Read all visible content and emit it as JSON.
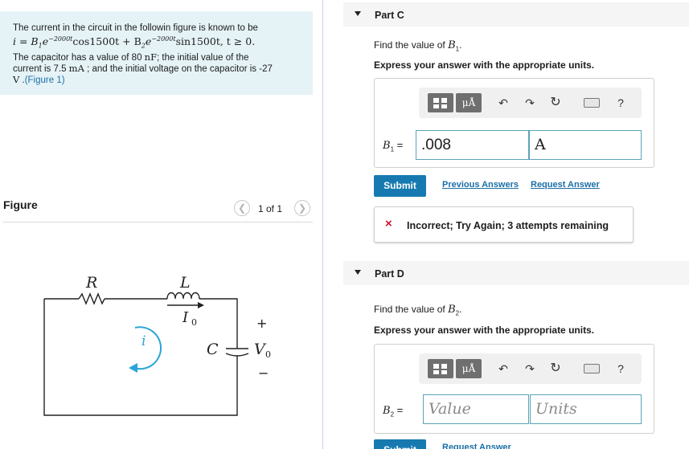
{
  "problem": {
    "line1": "The current in the circuit in the followin figure is known to be",
    "equation_part1": "i = B",
    "equation_sub1": "1",
    "equation_part2": "e",
    "equation_sup1": "−2000t",
    "equation_part3": "cos1500t + B",
    "equation_sub2": "2",
    "equation_part4": "e",
    "equation_sup2": "−2000t",
    "equation_part5": "sin1500t, t ≥ 0.",
    "line3a": "The capacitor has a value of 80 ",
    "line3b": "nF",
    "line3c": "; the initial value of the",
    "line4a": "current is 7.5 ",
    "line4b": "mA",
    "line4c": " ; and the initial voltage on the capacitor is -27",
    "line5a": "V",
    "line5b": " .",
    "figure_link": "(Figure 1)"
  },
  "figure": {
    "label": "Figure",
    "pager": "1 of 1",
    "prev_icon": "chevron-left-icon",
    "next_icon": "chevron-right-icon"
  },
  "circuit": {
    "R": "R",
    "L": "L",
    "I": "I",
    "I_sub": "0",
    "C": "C",
    "V": "V",
    "V_sub": "0",
    "i": "i",
    "plus": "+",
    "minus": "−"
  },
  "partC": {
    "title": "Part C",
    "prompt": "Find the value of ",
    "var": "B",
    "var_sub": "1",
    "prompt_end": ".",
    "instructions": "Express your answer with the appropriate units.",
    "label": "B",
    "label_sub": "1",
    "eq": "=",
    "value": ".008",
    "units": "A",
    "submit": "Submit",
    "prev_answers": "Previous Answers",
    "request_answer": "Request Answer",
    "feedback": "Incorrect; Try Again; 3 attempts remaining",
    "feedback_icon": "×"
  },
  "partD": {
    "title": "Part D",
    "prompt": "Find the value of ",
    "var": "B",
    "var_sub": "2",
    "prompt_end": ".",
    "instructions": "Express your answer with the appropriate units.",
    "label": "B",
    "label_sub": "2",
    "eq": "=",
    "value_placeholder": "Value",
    "units_placeholder": "Units",
    "submit": "Submit",
    "request_answer": "Request Answer"
  },
  "toolbar": {
    "mu": "μÅ",
    "help": "?",
    "undo_icon": "undo-icon",
    "redo_icon": "redo-icon",
    "reset_icon": "reset-icon",
    "keyboard_icon": "keyboard-icon"
  },
  "colors": {
    "problem_bg": "#e5f3f7",
    "accent": "#167ab0",
    "link": "#1b6fa6",
    "error": "#d0112b",
    "field_border": "#5aa3b8",
    "circuit_arrow": "#2aa4d9"
  }
}
